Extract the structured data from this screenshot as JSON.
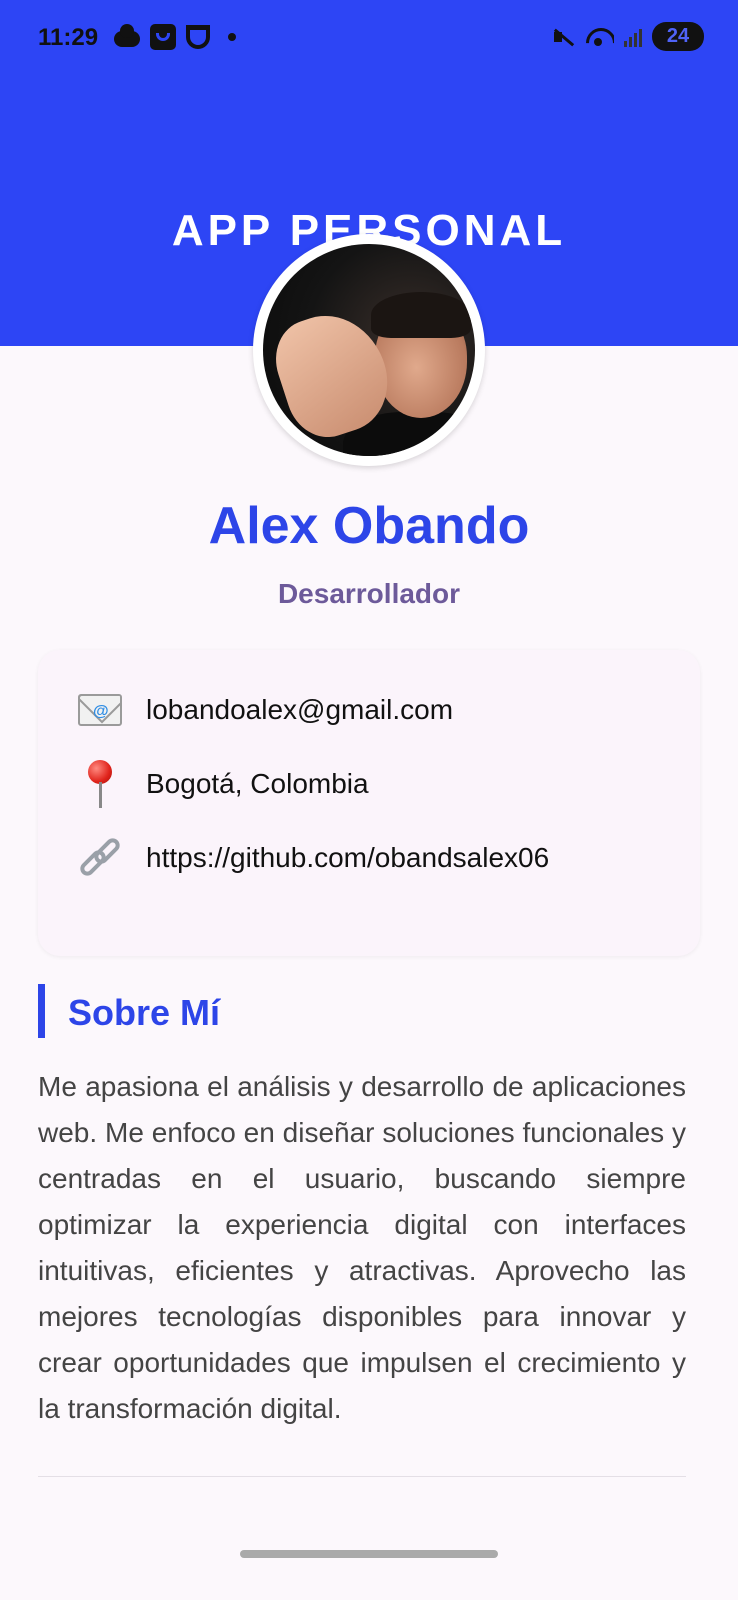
{
  "status_bar": {
    "time": "11:29",
    "battery": "24"
  },
  "header": {
    "title": "APP PERSONAL",
    "background_color": "#2d45f5"
  },
  "profile": {
    "name": "Alex Obando",
    "role": "Desarrollador",
    "avatar_icon": "profile-photo"
  },
  "contact": {
    "items": [
      {
        "icon": "envelope-icon",
        "text": "lobandoalex@gmail.com"
      },
      {
        "icon": "pin-icon",
        "text": "Bogotá, Colombia"
      },
      {
        "icon": "link-icon",
        "text": "https://github.com/obandsalex06"
      }
    ]
  },
  "about": {
    "title": "Sobre Mí",
    "text": "Me apasiona el análisis y desarrollo de aplicaciones web. Me enfoco en diseñar soluciones funcionales y centradas en el usuario, buscando siempre optimizar la experiencia digital con interfaces intuitivas, eficientes y atractivas. Aprovecho las mejores tecnologías disponibles para innovar y crear oportunidades que impulsen el crecimiento y la transformación digital."
  },
  "colors": {
    "accent": "#2d45e8",
    "role": "#6d5a9a",
    "background": "#fcf8fc"
  }
}
